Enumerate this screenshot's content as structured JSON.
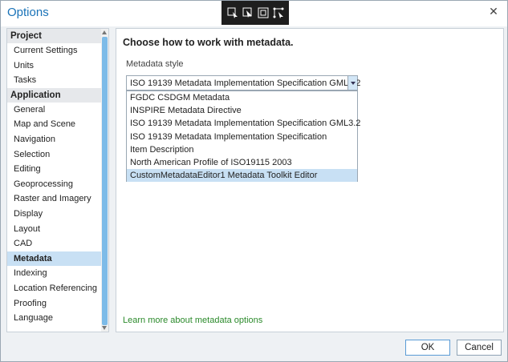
{
  "window": {
    "title": "Options"
  },
  "floating_toolbar": {
    "icons": [
      "cursor-select-icon",
      "pointer-icon",
      "frame-icon",
      "edit-vertices-icon"
    ]
  },
  "sidebar": {
    "groups": [
      {
        "label": "Project",
        "items": [
          "Current Settings",
          "Units",
          "Tasks"
        ]
      },
      {
        "label": "Application",
        "items": [
          "General",
          "Map and Scene",
          "Navigation",
          "Selection",
          "Editing",
          "Geoprocessing",
          "Raster and Imagery",
          "Display",
          "Layout",
          "CAD",
          "Metadata",
          "Indexing",
          "Location Referencing",
          "Proofing",
          "Language"
        ]
      }
    ],
    "selected": "Metadata"
  },
  "main": {
    "heading": "Choose how to work with metadata.",
    "style_label": "Metadata style",
    "selected_value": "ISO 19139 Metadata Implementation Specification GML3.2",
    "options": [
      "FGDC CSDGM Metadata",
      "INSPIRE Metadata Directive",
      "ISO 19139 Metadata Implementation Specification GML3.2",
      "ISO 19139 Metadata Implementation Specification",
      "Item Description",
      "North American Profile of ISO19115 2003",
      "CustomMetadataEditor1 Metadata Toolkit Editor"
    ],
    "highlighted_option": "CustomMetadataEditor1 Metadata Toolkit Editor",
    "learn_more": "Learn more about metadata options"
  },
  "buttons": {
    "ok": "OK",
    "cancel": "Cancel"
  },
  "colors": {
    "title": "#1a73b8",
    "selection": "#c8e0f4",
    "link": "#2b8a2b",
    "toolbar_bg": "#1e1e1e"
  }
}
